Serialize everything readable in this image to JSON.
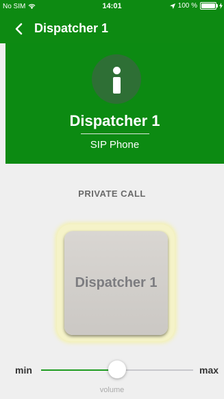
{
  "status_bar": {
    "carrier": "No SIM",
    "time": "14:01",
    "battery": "100 %",
    "icons": [
      "wifi-icon",
      "location-arrow-icon",
      "battery-icon",
      "charging-icon"
    ]
  },
  "nav": {
    "title": "Dispatcher 1",
    "back_icon": "chevron-left-icon"
  },
  "header": {
    "icon": "info-icon",
    "name": "Dispatcher 1",
    "type": "SIP Phone"
  },
  "main": {
    "section_label": "PRIVATE CALL",
    "call_button_label": "Dispatcher 1"
  },
  "volume": {
    "min_label": "min",
    "max_label": "max",
    "label": "volume",
    "level": 0.5
  },
  "colors": {
    "accent": "#0d8a12",
    "slider_fill": "#1f9d22",
    "glow": "#f3f0b4"
  }
}
